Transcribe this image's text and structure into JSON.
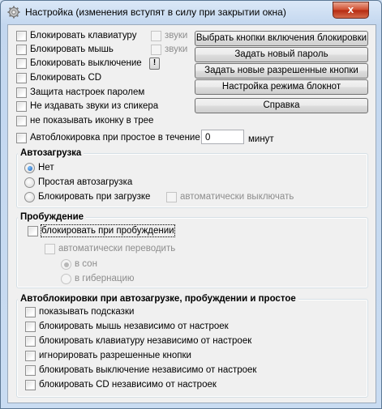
{
  "window": {
    "title": "Настройка (изменения вступят в силу при закрытии окна)",
    "close_glyph": "x"
  },
  "options": [
    {
      "label": "Блокировать клавиатуру",
      "checked": false
    },
    {
      "label": "Блокировать мышь",
      "checked": false
    },
    {
      "label": "Блокировать выключение",
      "checked": false
    },
    {
      "label": "Блокировать CD",
      "checked": false
    },
    {
      "label": "Защита настроек паролем",
      "checked": false
    },
    {
      "label": "Не издавать звуки из спикера",
      "checked": false
    },
    {
      "label": "не показывать иконку в трее",
      "checked": false
    },
    {
      "label": "Автоблокировка при простое в течение",
      "checked": false
    }
  ],
  "sounds": [
    {
      "label": "звуки",
      "enabled": false
    },
    {
      "label": "звуки",
      "enabled": false
    }
  ],
  "info_button": "!",
  "idle": {
    "value": "0",
    "unit": "минут"
  },
  "buttons": {
    "choose_keys": "Выбрать кнопки включения блокировки",
    "new_password": "Задать новый пароль",
    "allowed_keys": "Задать новые разрешенные кнопки",
    "notebook_mode": "Настройка режима блокнот",
    "help": "Справка"
  },
  "autoload": {
    "title": "Автозагрузка",
    "radios": [
      {
        "label": "Нет",
        "selected": true
      },
      {
        "label": "Простая автозагрузка",
        "selected": false
      },
      {
        "label": "Блокировать при загрузке",
        "selected": false
      }
    ],
    "auto_off": "автоматически выключать"
  },
  "wakeup": {
    "title": "Пробуждение",
    "block_on_wake": "блокировать при пробуждении",
    "auto_switch": "автоматически переводить",
    "radios": [
      {
        "label": "в сон",
        "selected": true
      },
      {
        "label": "в гибернацию",
        "selected": false
      }
    ]
  },
  "autoblock": {
    "title": "Автоблокировки при автозагрузке, пробуждении и простое",
    "items": [
      "показывать подсказки",
      "блокировать мышь независимо от настроек",
      "блокировать клавиатуру независимо от настроек",
      "игнорировать разрешенные кнопки",
      "блокировать выключение независимо от настроек",
      "блокировать CD независимо от настроек"
    ]
  }
}
